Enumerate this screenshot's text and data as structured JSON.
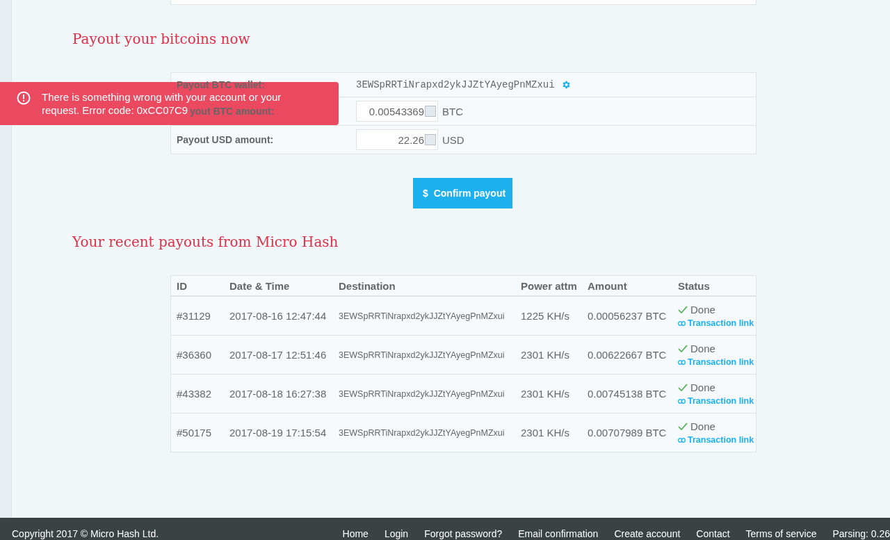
{
  "payout_section": {
    "title": "Payout your bitcoins now",
    "fields": [
      {
        "kind": "wallet",
        "label": "Payout BTC wallet:",
        "value": "3EWSpRRTiNrapxd2ykJJZtYAyegPnMZxui"
      },
      {
        "kind": "amount",
        "label": "yout BTC amount:",
        "partly_covered": true,
        "value": "0.00543369",
        "unit": "BTC"
      },
      {
        "kind": "amount",
        "label": "Payout USD amount:",
        "value": "22.26",
        "unit": "USD"
      }
    ],
    "button": "Confirm payout",
    "button_icon": "$"
  },
  "toast": {
    "lines": [
      "There is something wrong with your account or your",
      "request. Error code: 0xCC07C9"
    ]
  },
  "recent_section": {
    "title": "Your recent payouts from Micro Hash",
    "columns": [
      "ID",
      "Date & Time",
      "Destination",
      "Power attm",
      "Amount",
      "Status"
    ],
    "rows": [
      {
        "id": "#31129",
        "datetime": "2017-08-16 12:47:44",
        "destination": "3EWSpRRTiNrapxd2ykJJZtYAyegPnMZxui",
        "power": "1225 KH/s",
        "amount": "0.00056237 BTC",
        "status": "Done",
        "link": "Transaction link"
      },
      {
        "id": "#36360",
        "datetime": "2017-08-17 12:51:46",
        "destination": "3EWSpRRTiNrapxd2ykJJZtYAyegPnMZxui",
        "power": "2301 KH/s",
        "amount": "0.00622667 BTC",
        "status": "Done",
        "link": "Transaction link"
      },
      {
        "id": "#43382",
        "datetime": "2017-08-18 16:27:38",
        "destination": "3EWSpRRTiNrapxd2ykJJZtYAyegPnMZxui",
        "power": "2301 KH/s",
        "amount": "0.00745138 BTC",
        "status": "Done",
        "link": "Transaction link"
      },
      {
        "id": "#50175",
        "datetime": "2017-08-19 17:15:54",
        "destination": "3EWSpRRTiNrapxd2ykJJZtYAyegPnMZxui",
        "power": "2301 KH/s",
        "amount": "0.00707989 BTC",
        "status": "Done",
        "link": "Transaction link"
      }
    ]
  },
  "footer": {
    "copyright": "Copyright 2017 © Micro Hash Ltd.",
    "links": [
      "Home",
      "Login",
      "Forgot password?",
      "Email confirmation",
      "Create account",
      "Contact",
      "Terms of service"
    ],
    "parsing": "Parsing: 0.26"
  }
}
